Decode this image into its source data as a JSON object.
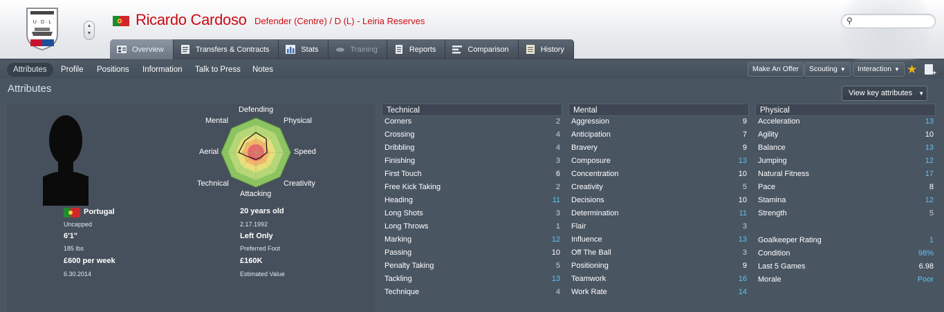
{
  "header": {
    "name": "Ricardo Cardoso",
    "subtitle": "Defender (Centre) / D (L) - Leiria Reserves",
    "club_badge_text": "U D L",
    "search_placeholder": ""
  },
  "tabs": [
    {
      "label": "Overview",
      "icon": "person-card-icon",
      "active": true
    },
    {
      "label": "Transfers & Contracts",
      "icon": "document-icon"
    },
    {
      "label": "Stats",
      "icon": "stats-icon"
    },
    {
      "label": "Training",
      "icon": "training-icon",
      "disabled": true
    },
    {
      "label": "Reports",
      "icon": "report-icon"
    },
    {
      "label": "Comparison",
      "icon": "comparison-icon"
    },
    {
      "label": "History",
      "icon": "history-icon"
    }
  ],
  "subnav": {
    "items": [
      "Attributes",
      "Profile",
      "Positions",
      "Information",
      "Talk to Press",
      "Notes"
    ],
    "actions": {
      "make_offer": "Make An Offer",
      "scouting": "Scouting",
      "interaction": "Interaction"
    }
  },
  "section": {
    "title": "Attributes",
    "view_key": "View key attributes"
  },
  "profile": {
    "nationality": "Portugal",
    "caps": "Uncapped",
    "height": "6'1\"",
    "weight": "185 lbs",
    "wage": "£600 per week",
    "contract_end": "6.30.2014",
    "age": "20 years old",
    "dob": "2.17.1992",
    "foot": "Left Only",
    "foot_label": "Preferred Foot",
    "value": "£160K",
    "value_label": "Estimated Value"
  },
  "radar": {
    "labels": {
      "defending": "Defending",
      "physical": "Physical",
      "speed": "Speed",
      "creativity": "Creativity",
      "attacking": "Attacking",
      "technical": "Technical",
      "aerial": "Aerial",
      "mental": "Mental"
    }
  },
  "technical": {
    "title": "Technical",
    "rows": [
      {
        "name": "Corners",
        "value": "2"
      },
      {
        "name": "Crossing",
        "value": "4"
      },
      {
        "name": "Dribbling",
        "value": "4"
      },
      {
        "name": "Finishing",
        "value": "3"
      },
      {
        "name": "First Touch",
        "value": "6"
      },
      {
        "name": "Free Kick Taking",
        "value": "2"
      },
      {
        "name": "Heading",
        "value": "11"
      },
      {
        "name": "Long Shots",
        "value": "3"
      },
      {
        "name": "Long Throws",
        "value": "1"
      },
      {
        "name": "Marking",
        "value": "12"
      },
      {
        "name": "Passing",
        "value": "10"
      },
      {
        "name": "Penalty Taking",
        "value": "5"
      },
      {
        "name": "Tackling",
        "value": "13"
      },
      {
        "name": "Technique",
        "value": "4"
      }
    ]
  },
  "mental": {
    "title": "Mental",
    "rows": [
      {
        "name": "Aggression",
        "value": "9"
      },
      {
        "name": "Anticipation",
        "value": "7"
      },
      {
        "name": "Bravery",
        "value": "9"
      },
      {
        "name": "Composure",
        "value": "13"
      },
      {
        "name": "Concentration",
        "value": "10"
      },
      {
        "name": "Creativity",
        "value": "5"
      },
      {
        "name": "Decisions",
        "value": "10"
      },
      {
        "name": "Determination",
        "value": "11"
      },
      {
        "name": "Flair",
        "value": "3"
      },
      {
        "name": "Influence",
        "value": "13"
      },
      {
        "name": "Off The Ball",
        "value": "3"
      },
      {
        "name": "Positioning",
        "value": "9"
      },
      {
        "name": "Teamwork",
        "value": "16"
      },
      {
        "name": "Work Rate",
        "value": "14"
      }
    ]
  },
  "physical": {
    "title": "Physical",
    "rows": [
      {
        "name": "Acceleration",
        "value": "13"
      },
      {
        "name": "Agility",
        "value": "10"
      },
      {
        "name": "Balance",
        "value": "13"
      },
      {
        "name": "Jumping",
        "value": "12"
      },
      {
        "name": "Natural Fitness",
        "value": "17"
      },
      {
        "name": "Pace",
        "value": "8"
      },
      {
        "name": "Stamina",
        "value": "12"
      },
      {
        "name": "Strength",
        "value": "5"
      }
    ],
    "extra": [
      {
        "name": "Goalkeeper Rating",
        "value": "1"
      },
      {
        "name": "Condition",
        "value": "98%"
      },
      {
        "name": "Last 5 Games",
        "value": "6.98"
      },
      {
        "name": "Morale",
        "value": "Poor"
      }
    ]
  },
  "colors": {
    "name_red": "#cc0a12",
    "high_value": "#5ec4f0",
    "star": "#f3b610"
  }
}
